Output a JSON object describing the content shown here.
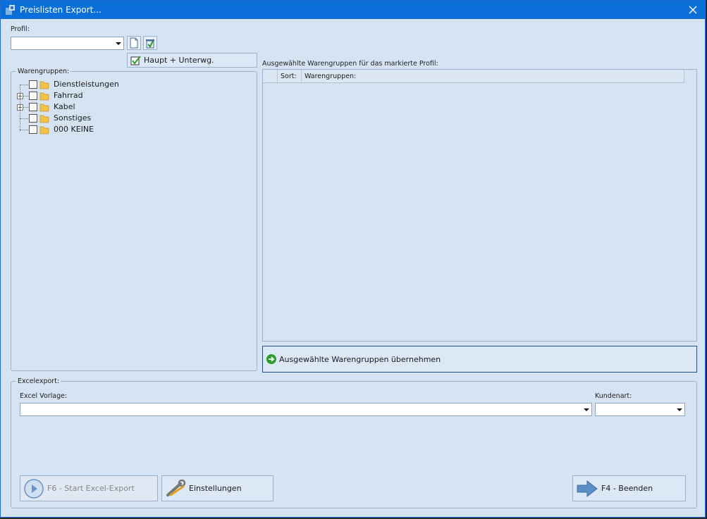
{
  "window": {
    "title": "Preislisten Export..."
  },
  "profil": {
    "label": "Profil:",
    "value": "",
    "haupt_button": "Haupt + Unterwg."
  },
  "warengruppen": {
    "legend": "Warengruppen:",
    "items": [
      {
        "label": "Dienstleistungen",
        "expandable": false
      },
      {
        "label": "Fahrrad",
        "expandable": true
      },
      {
        "label": "Kabel",
        "expandable": true
      },
      {
        "label": "Sonstiges",
        "expandable": false
      },
      {
        "label": "000 KEINE",
        "expandable": false
      }
    ]
  },
  "selected": {
    "caption": "Ausgewählte Warengruppen für das markierte Profil:",
    "columns": [
      "Sort:",
      "Warengruppen:"
    ],
    "apply_button": "Ausgewählte Warengruppen übernehmen"
  },
  "excel": {
    "legend": "Excelexport:",
    "vorlage_label": "Excel Vorlage:",
    "vorlage_value": "",
    "kundenart_label": "Kundenart:",
    "kundenart_value": ""
  },
  "actions": {
    "start_export": "F6 - Start Excel-Export",
    "settings": "Einstellungen",
    "quit": "F4 - Beenden"
  },
  "icons": {
    "app": "app-icon",
    "close": "close-icon",
    "new": "new-document-icon",
    "delete": "delete-profile-icon",
    "check": "checkbox-check-icon",
    "folder": "folder-icon",
    "green_arrow": "green-arrow-right-icon",
    "play": "play-icon",
    "wrench": "wrench-icon",
    "exit": "exit-arrow-icon"
  },
  "colors": {
    "titlebar": "#0a6fd8",
    "background": "#d6e3f2",
    "accent_green": "#2a9d2a",
    "exit_arrow": "#5b8ec6"
  }
}
